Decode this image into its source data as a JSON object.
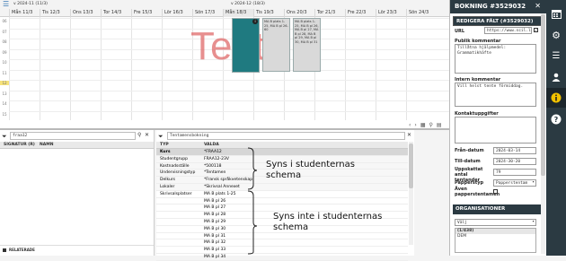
{
  "calendar": {
    "week_label_1": "v 2024-11 (11/3)",
    "week_label_2": "v 2024-12 (18/3)",
    "days": [
      "Mån 11/3",
      "Tis 12/3",
      "Ons 13/3",
      "Tor 14/3",
      "Fre 15/3",
      "Lör 16/3",
      "Sön 17/3",
      "Mån 18/3",
      "Tis 19/3",
      "Ons 20/3",
      "Tor 21/3",
      "Fre 22/3",
      "Lör 23/3",
      "Sön 24/3"
    ],
    "hours": [
      "06",
      "07",
      "08",
      "09",
      "10",
      "11",
      "12",
      "13",
      "14",
      "15"
    ],
    "watermark": "Tent",
    "event_tue_text": "MA B plats 1-25, MA B pl 26-60",
    "event_wed_text": "MA B plats 1-25, MA B pl 26, MA B pl 27, MA B pl 28, MA B pl 29, MA B pl 30, MA B pl 31",
    "event_badge": "i",
    "colors": {
      "selected_event": "#1f7a80",
      "other_event": "#d9d9d9",
      "watermark": "#e06a6a"
    }
  },
  "left_pane": {
    "search_value": "fraa12",
    "col_signature": "SIGNATUR (R)",
    "col_name": "NAMN",
    "footer_label": "RELATERADE"
  },
  "mid_pane": {
    "dropdown_value": "Tentamensbokning",
    "col_typ": "TYP",
    "col_valda": "VALDA",
    "rows": [
      {
        "typ": "Kurs",
        "val": "*FRAA12"
      },
      {
        "typ": "Studentgrupp",
        "val": "FRAA12-23V"
      },
      {
        "typ": "Kostnadsställe",
        "val": "*500118"
      },
      {
        "typ": "Undervisningstyp",
        "val": "*Tentamen"
      },
      {
        "typ": "Delkurs",
        "val": "*Fransk språkvetenskap"
      },
      {
        "typ": "Lokaler",
        "val": "*Skrivsal Annexet"
      },
      {
        "typ": "Skrivsalsplatser",
        "val": "MA B plats 1-25"
      },
      {
        "typ": "",
        "val": "MA B pl 26"
      },
      {
        "typ": "",
        "val": "MA B pl 27"
      },
      {
        "typ": "",
        "val": "MA B pl 28"
      },
      {
        "typ": "",
        "val": "MA B pl 29"
      },
      {
        "typ": "",
        "val": "MA B pl 30"
      },
      {
        "typ": "",
        "val": "MA B pl 31"
      },
      {
        "typ": "",
        "val": "MA B pl 32"
      },
      {
        "typ": "",
        "val": "MA B pl 33"
      },
      {
        "typ": "",
        "val": "MA B pl 34"
      }
    ]
  },
  "annotations": {
    "visible_line1": "Syns i studenternas",
    "visible_line2": "schema",
    "hidden_line1": "Syns inte i studenternas",
    "hidden_line2": "schema"
  },
  "side_panel": {
    "title": "BOKNING #3529032",
    "section_title": "REDIGERA FÄLT (#3529032)",
    "url_label": "URL",
    "url_value": "https://www.scil.lu",
    "public_comment_label": "Publik kommentar",
    "public_comment_value": "Tillåtna hjälpmedel: Grammatikhäfte",
    "internal_comment_label": "Intern kommentar",
    "internal_comment_value": "Vill helst tente förmiddag.",
    "contact_label": "Kontaktuppgifter",
    "from_date_label": "Från-datum",
    "from_date_value": "2024-03-14",
    "to_date_label": "Till-datum",
    "to_date_value": "2024-30-20",
    "count_label": "Uppskattat antal tentander",
    "count_value": "79",
    "paper_type_label": "Papperstyp",
    "paper_type_value": "Papperstentam",
    "also_paper_label": "Även papperstentamen",
    "org_title": "ORGANISATIONER",
    "org_select": "Välj",
    "org_count": "(1/438)",
    "org_item": "DEM"
  }
}
